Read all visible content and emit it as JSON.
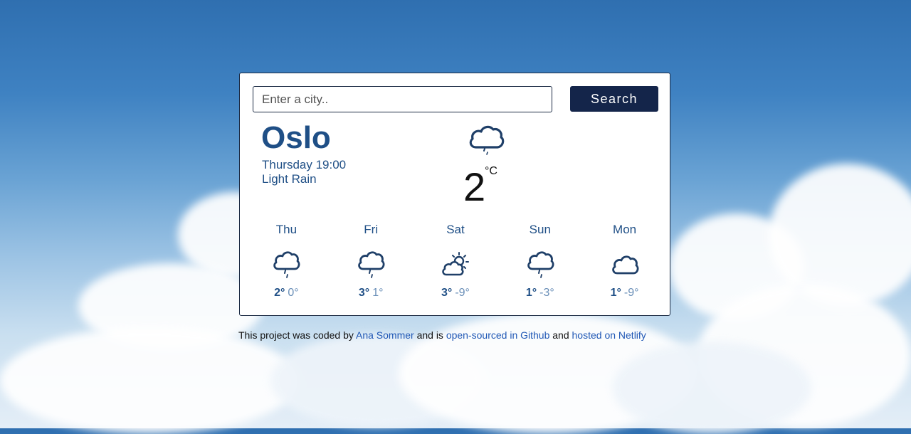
{
  "search": {
    "placeholder": "Enter a city..",
    "button_label": "Search"
  },
  "current": {
    "city": "Oslo",
    "datetime": "Thursday 19:00",
    "condition": "Light Rain",
    "temperature": "2",
    "unit": "°C",
    "icon": "rain-cloud-icon"
  },
  "forecast": [
    {
      "day": "Thu",
      "max": "2°",
      "min": "0°",
      "icon": "rain-cloud-icon"
    },
    {
      "day": "Fri",
      "max": "3°",
      "min": "1°",
      "icon": "rain-cloud-icon"
    },
    {
      "day": "Sat",
      "max": "3°",
      "min": "-9°",
      "icon": "partly-cloudy-icon"
    },
    {
      "day": "Sun",
      "max": "1°",
      "min": "-3°",
      "icon": "rain-cloud-icon"
    },
    {
      "day": "Mon",
      "max": "1°",
      "min": "-9°",
      "icon": "cloud-icon"
    }
  ],
  "footer": {
    "text1": "This project was coded by",
    "author": "Ana Sommer",
    "text2": "and is",
    "github_link": "open-sourced in Github",
    "text3": "and",
    "netlify_link": "hosted on Netlify"
  },
  "colors": {
    "primary": "#1f4f86",
    "button": "#14254a",
    "link": "#1f57b5"
  }
}
